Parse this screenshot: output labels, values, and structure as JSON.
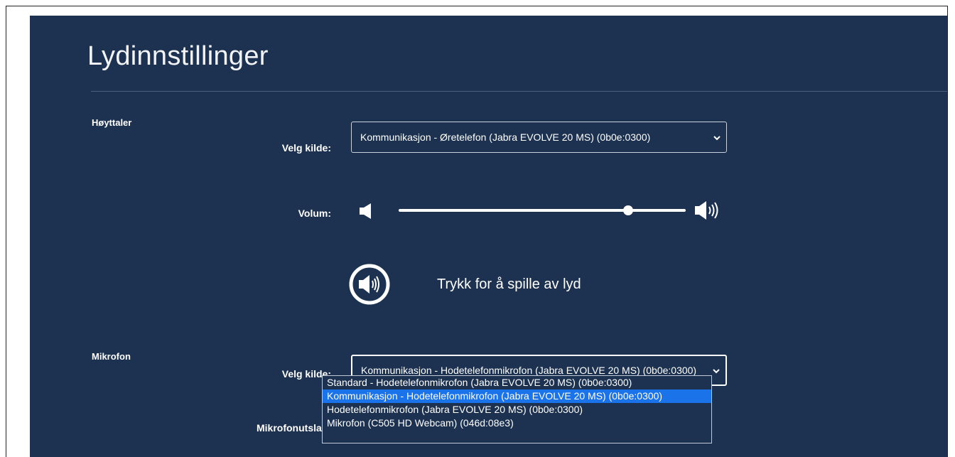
{
  "page": {
    "title": "Lydinnstillinger"
  },
  "speaker": {
    "section_label": "Høyttaler",
    "source_label": "Velg kilde:",
    "source_value": "Kommunikasjon - Øretelefon (Jabra EVOLVE 20 MS) (0b0e:0300)",
    "volume_label": "Volum:",
    "volume_level": 0.8,
    "play_label": "Trykk for å spille av lyd"
  },
  "microphone": {
    "section_label": "Mikrofon",
    "source_label": "Velg kilde:",
    "source_value": "Kommunikasjon - Hodetelefonmikrofon (Jabra EVOLVE 20 MS) (0b0e:0300)",
    "level_label": "Mikrofonutslag:",
    "options": [
      "Standard - Hodetelefonmikrofon (Jabra EVOLVE 20 MS) (0b0e:0300)",
      "Kommunikasjon - Hodetelefonmikrofon (Jabra EVOLVE 20 MS) (0b0e:0300)",
      "Hodetelefonmikrofon (Jabra EVOLVE 20 MS) (0b0e:0300)",
      "Mikrofon (C505 HD Webcam) (046d:08e3)"
    ],
    "selected_index": 1
  },
  "icons": {
    "volume_low": "speaker-low-icon",
    "volume_high": "speaker-high-icon",
    "play": "play-sound-icon",
    "chevron": "chevron-down-icon"
  },
  "colors": {
    "panel_bg": "#1c3250",
    "selected_option": "#1a73e8"
  }
}
